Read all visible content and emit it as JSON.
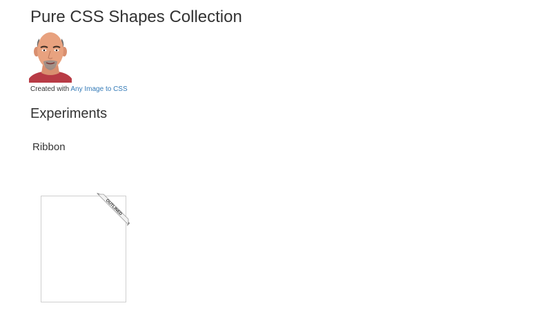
{
  "header": {
    "title": "Pure CSS Shapes Collection"
  },
  "avatar": {
    "icon": "bald-man-avatar-icon"
  },
  "credit": {
    "prefix": "Created with",
    "link_label": "Any Image to CSS"
  },
  "experiments": {
    "heading": "Experiments",
    "ribbon": {
      "heading": "Ribbon",
      "label": "OUTLINED"
    }
  },
  "colors": {
    "link": "#337ab7",
    "text": "#333333",
    "skin": "#e8a27f",
    "shirt": "#b83b45",
    "card_border": "#cfcfcf"
  }
}
